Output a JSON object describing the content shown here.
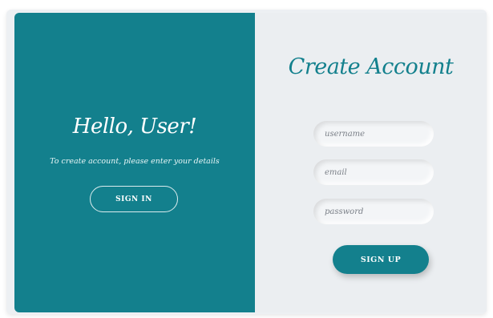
{
  "welcome_panel": {
    "title": "Hello, User!",
    "subtitle": "To create account, please enter your details",
    "signin_label": "SIGN IN"
  },
  "signup_form": {
    "title": "Create Account",
    "fields": [
      {
        "placeholder": "username",
        "value": ""
      },
      {
        "placeholder": "email",
        "value": ""
      },
      {
        "placeholder": "password",
        "value": ""
      }
    ],
    "signup_label": "SIGN UP"
  },
  "colors": {
    "accent": "#13808d",
    "panel_background": "#ebeef1",
    "text_on_accent": "#ffffff"
  }
}
